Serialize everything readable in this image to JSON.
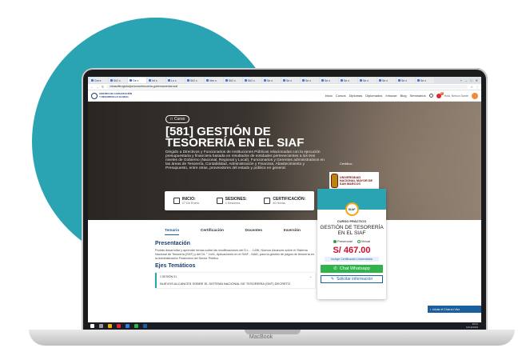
{
  "browser": {
    "tabs": [
      "Gm e",
      "SIG x",
      "Ge x",
      "Inf x",
      "Lo x",
      "SIG x",
      "Ven x",
      "SIG x",
      "SIG x",
      "Se x",
      "Se x",
      "Se x",
      "Se x",
      "Se x",
      "Se x",
      "Se x",
      "Se x",
      "Se x",
      "Se x"
    ],
    "url": "cibasofttroglobalpe/curso/tesoreria-gubernamental-siaf"
  },
  "site": {
    "logo_line1": "CENTRO DE CAPACITACIÓN",
    "logo_line2": "Y DESARROLLO GLOBAL",
    "menu": [
      "Inicio",
      "Cursos",
      "Diplomas",
      "Diplomados",
      "Inhouse",
      "Blog",
      "Seminarios"
    ],
    "cart_count": "0",
    "user_name": "Hola, Nelson Dante"
  },
  "hero": {
    "badge": "Curso",
    "title": "[581] GESTIÓN DE TESORERÍA EN EL SIAF",
    "description": "Dirigido a Directivos y Funcionarios de Instituciones Públicas relacionadas con la ejecución presupuestaria y financiera basada en resultados de entidades pertenecientes a los tres niveles de Gobierno (Nacional, Regional y Local). Funcionarios y Gerentes administrativos en las áreas de Tesorería, Contabilidad, Administración y Finanzas, Abastecimiento y Presupuesto, entre otras, proveedores del estado y público en general.",
    "cert_label": "Certifica:",
    "university": "UNIVERSIDAD NACIONAL MAYOR DE SAN MARCOS"
  },
  "info": [
    {
      "title": "INICIO:",
      "sub": "27 De Enero"
    },
    {
      "title": "SESIONES:",
      "sub": "4 Sesiones"
    },
    {
      "title": "CERTIFICACIÓN:",
      "sub": "40 Horas"
    }
  ],
  "card": {
    "icon_text": "SIAF",
    "type": "CURSO PRÁCTICO",
    "name": "GESTIÓN DE TESORERÍA EN EL SIAF",
    "mode_1": "Presencial",
    "mode_2": "Virtual",
    "price": "S/ 467.00",
    "includes": "Incluye Certificación Universitaria",
    "whatsapp": "Chat Whatsapp",
    "request": "Solicitar información"
  },
  "tabs": [
    "Temario",
    "Certificación",
    "Docentes",
    "Inversión"
  ],
  "content": {
    "heading": "Presentación",
    "paragraph": "Podrás desarrollar y aprender temas sobre las modificaciones del D.L. - 1436, Nuevos Alcances sobre el Sistema Nacional de Tesorería (SNT) y del DL ° 1441, Aplicaciones en el SIAF - MAD, para la gestión de pagos de tesorería en la Administración Financiera del Sector Público",
    "topics_heading": "Ejes Temáticos",
    "session_label": "1 SESIÓN 01",
    "session_title": "NUEVOS ALCANCES SOBRE EL SISTEMA NACIONAL DE TESORERÍA (SNT) DECRETO"
  },
  "chat": "Iniciar el Chat en Vivo",
  "taskbar": {
    "time": "19:21",
    "date": "12/12/2019"
  },
  "device": "MacBook"
}
